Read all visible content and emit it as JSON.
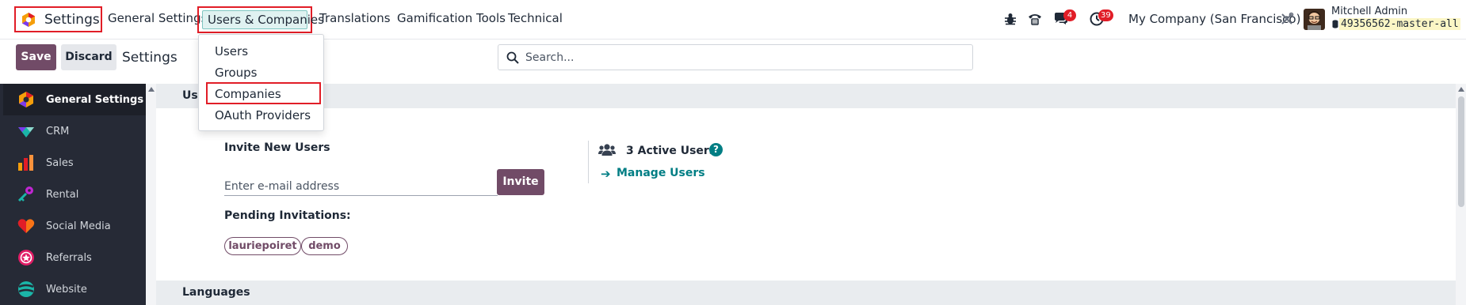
{
  "navbar": {
    "app_name": "Settings",
    "menu": [
      "General Settings",
      "Users & Companies",
      "Translations",
      "Gamification Tools",
      "Technical"
    ],
    "active_menu": "Users & Companies",
    "icons": [
      "bug-icon",
      "phone-icon",
      "chat-icon",
      "activity-clock-icon",
      "debug-tools-icon"
    ],
    "chat_badge": "4",
    "activity_badge": "39",
    "company": "My Company (San Francisco)",
    "user_name": "Mitchell Admin",
    "database": "49356562-master-all",
    "accent_color": "#714b67",
    "highlight_color": "#e11d27"
  },
  "dropdown": {
    "items": [
      "Users",
      "Groups",
      "Companies",
      "OAuth Providers"
    ],
    "highlighted": "Companies"
  },
  "control_panel": {
    "save_label": "Save",
    "discard_label": "Discard",
    "title": "Settings",
    "search_placeholder": "Search..."
  },
  "sidebar": {
    "items": [
      {
        "label": "General Settings",
        "icon": "settings-hex-icon",
        "active": true
      },
      {
        "label": "CRM",
        "icon": "crm-icon"
      },
      {
        "label": "Sales",
        "icon": "sales-chart-icon"
      },
      {
        "label": "Rental",
        "icon": "key-icon"
      },
      {
        "label": "Social Media",
        "icon": "heart-icon"
      },
      {
        "label": "Referrals",
        "icon": "referral-icon"
      },
      {
        "label": "Website",
        "icon": "website-icon"
      }
    ]
  },
  "users_section": {
    "header": "Users",
    "invite_title": "Invite New Users",
    "email_placeholder": "Enter e-mail address",
    "invite_button": "Invite",
    "pending_title": "Pending Invitations:",
    "pending": [
      "lauriepoiret",
      "demo"
    ],
    "active_users": "3 Active Users",
    "manage_users": "Manage Users",
    "help": "?"
  },
  "languages_section": {
    "header": "Languages"
  }
}
